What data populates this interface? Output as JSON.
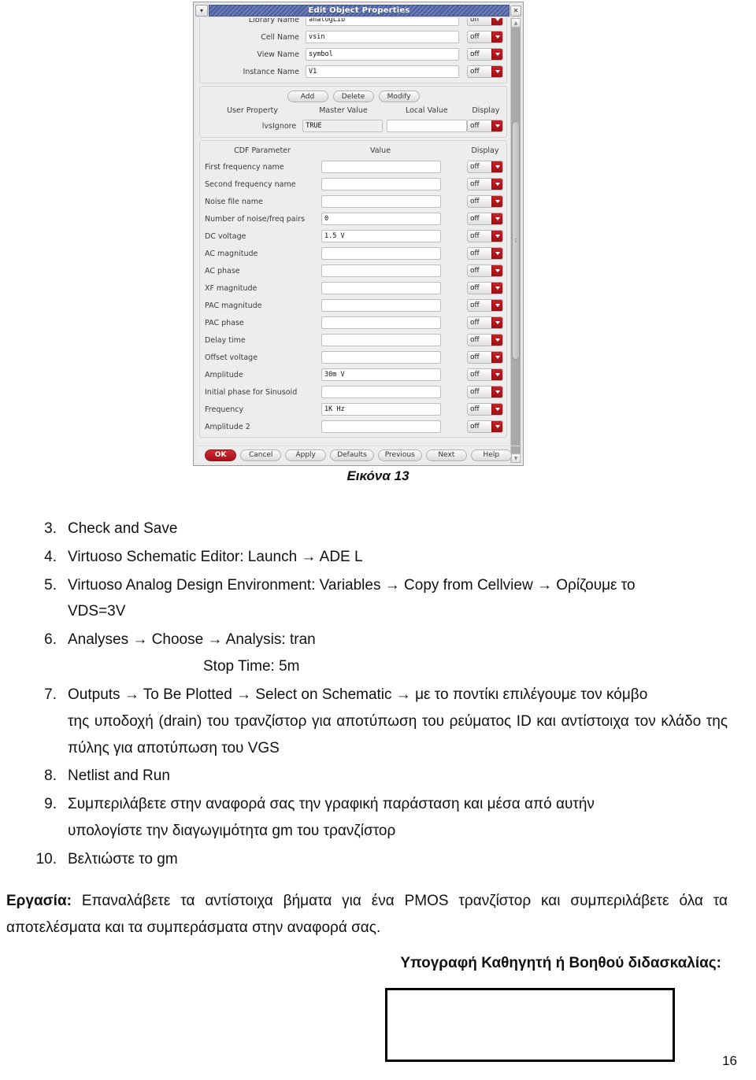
{
  "dialog": {
    "title": "Edit Object Properties",
    "menu_icon": "chevron-down-icon",
    "close_icon": "close-icon",
    "identity_fields": [
      {
        "label": "Library Name",
        "value": "analogLib",
        "display": "off"
      },
      {
        "label": "Cell Name",
        "value": "vsin",
        "display": "off"
      },
      {
        "label": "View Name",
        "value": "symbol",
        "display": "off"
      },
      {
        "label": "Instance Name",
        "value": "V1",
        "display": "off"
      }
    ],
    "property_buttons": [
      "Add",
      "Delete",
      "Modify"
    ],
    "property_headers": [
      "User Property",
      "Master Value",
      "Local Value",
      "Display"
    ],
    "user_properties": [
      {
        "name": "lvsIgnore",
        "master_value": "TRUE",
        "local_value": "",
        "display": "off"
      }
    ],
    "cdf_headers": [
      "CDF Parameter",
      "Value",
      "Display"
    ],
    "cdf_parameters": [
      {
        "name": "First frequency name",
        "value": "",
        "display": "off"
      },
      {
        "name": "Second frequency name",
        "value": "",
        "display": "off"
      },
      {
        "name": "Noise file name",
        "value": "",
        "display": "off"
      },
      {
        "name": "Number of noise/freq pairs",
        "value": "0",
        "display": "off"
      },
      {
        "name": "DC voltage",
        "value": "1.5 V",
        "display": "off"
      },
      {
        "name": "AC magnitude",
        "value": "",
        "display": "off"
      },
      {
        "name": "AC phase",
        "value": "",
        "display": "off"
      },
      {
        "name": "XF magnitude",
        "value": "",
        "display": "off"
      },
      {
        "name": "PAC magnitude",
        "value": "",
        "display": "off"
      },
      {
        "name": "PAC phase",
        "value": "",
        "display": "off"
      },
      {
        "name": "Delay time",
        "value": "",
        "display": "off"
      },
      {
        "name": "Offset voltage",
        "value": "",
        "display": "off"
      },
      {
        "name": "Amplitude",
        "value": "30m V",
        "display": "off"
      },
      {
        "name": "Initial phase for Sinusoid",
        "value": "",
        "display": "off"
      },
      {
        "name": "Frequency",
        "value": "1K Hz",
        "display": "off"
      },
      {
        "name": "Amplitude 2",
        "value": "",
        "display": "off"
      }
    ],
    "footer_buttons": [
      "OK",
      "Cancel",
      "Apply",
      "Defaults",
      "Previous",
      "Next",
      "Help"
    ],
    "scrollbar": {
      "up_icon": "triangle-up-icon",
      "down_icon": "triangle-down-icon"
    },
    "colors": {
      "titlebar": "#4f63a4",
      "accent_red": "#b41a21",
      "panel_bg": "#ededed"
    }
  },
  "figure_caption": "Εικόνα 13",
  "steps": [
    {
      "num": "3.",
      "text": "Check and Save",
      "sub": null
    },
    {
      "num": "4.",
      "text": "Virtuoso Schematic Editor:   Launch → ADE L",
      "sub": null
    },
    {
      "num": "5.",
      "text": "Virtuoso Analog Design Environment: Variables → Copy from Cellview → Ορίζουμε το",
      "sub": "VDS=3V"
    },
    {
      "num": "6.",
      "text": "Analyses → Choose → Analysis: tran",
      "sub": "Stop Time: 5m"
    },
    {
      "num": "7.",
      "text": "Outputs → To Be Plotted → Select on Schematic → με το ποντίκι επιλέγουμε τον κόμβο",
      "sub": "της υποδοχή (drain) του τρανζίστορ για αποτύπωση του ρεύματος ID και αντίστοιχα τον κλάδο της πύλης για  αποτύπωση του VGS"
    },
    {
      "num": "8.",
      "text": "Netlist and Run",
      "sub": null
    },
    {
      "num": "9.",
      "text": "Συμπεριλάβετε στην αναφορά σας την γραφική παράσταση και μέσα από αυτήν",
      "sub": "υπολογίστε την διαγωγιμότητα gm του τρανζίστορ"
    },
    {
      "num": "10.",
      "text": "Βελτιώστε το gm",
      "sub": null
    }
  ],
  "task": {
    "label": "Εργασία:",
    "text": " Επαναλάβετε τα αντίστοιχα βήματα για ένα PMOS τρανζίστορ και συμπεριλάβετε όλα τα αποτελέσματα και τα συμπεράσματα στην αναφορά σας."
  },
  "signature": {
    "label": "Υπογραφή Καθηγητή ή Βοηθού διδασκαλίας:"
  },
  "page_number": "16"
}
